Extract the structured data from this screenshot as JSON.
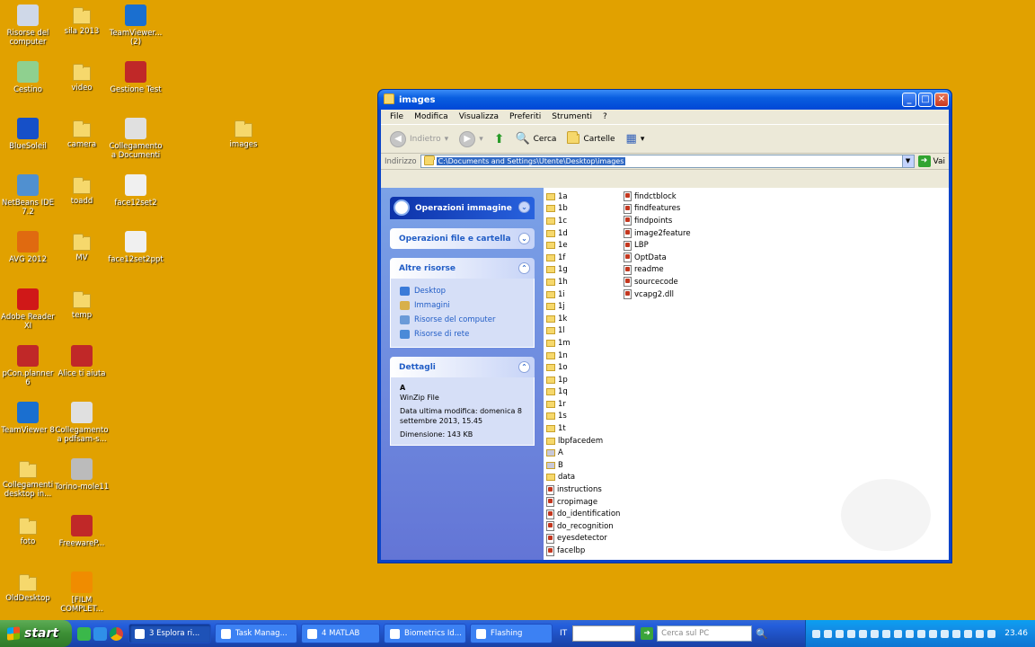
{
  "desktop": {
    "icons": [
      {
        "label": "Risorse del computer",
        "icon": "computer-icon"
      },
      {
        "label": "sila 2013",
        "icon": "folder-icon"
      },
      {
        "label": "TeamViewer... (2)",
        "icon": "teamviewer-icon"
      },
      {
        "label": "Cestino",
        "icon": "recycle-bin-icon"
      },
      {
        "label": "video",
        "icon": "folder-icon"
      },
      {
        "label": "Gestione Test",
        "icon": "app-icon"
      },
      {
        "label": "BlueSoleil",
        "icon": "bluetooth-icon"
      },
      {
        "label": "camera",
        "icon": "folder-icon"
      },
      {
        "label": "Collegamento a Documenti",
        "icon": "shortcut-icon"
      },
      {
        "label": "images",
        "icon": "folder-icon"
      },
      {
        "label": "NetBeans IDE 7.2",
        "icon": "netbeans-icon"
      },
      {
        "label": "toadd",
        "icon": "folder-icon"
      },
      {
        "label": "face12set2",
        "icon": "file-icon"
      },
      {
        "label": "AVG 2012",
        "icon": "avg-icon"
      },
      {
        "label": "MV",
        "icon": "folder-icon"
      },
      {
        "label": "face12set2ppt",
        "icon": "file-icon"
      },
      {
        "label": "Adobe Reader XI",
        "icon": "adobe-icon"
      },
      {
        "label": "temp",
        "icon": "folder-icon"
      },
      {
        "label": "pCon.planner 6",
        "icon": "app-icon"
      },
      {
        "label": "Alice ti aiuta",
        "icon": "app-icon"
      },
      {
        "label": "TeamViewer 8",
        "icon": "teamviewer-icon"
      },
      {
        "label": "Collegamento a pdfsam-s...",
        "icon": "shortcut-icon"
      },
      {
        "label": "Collegamenti desktop in...",
        "icon": "folder-icon"
      },
      {
        "label": "Torino-mole11",
        "icon": "image-icon"
      },
      {
        "label": "foto",
        "icon": "folder-icon"
      },
      {
        "label": "FreewareP...",
        "icon": "app-icon"
      },
      {
        "label": "OldDesktop",
        "icon": "folder-icon"
      },
      {
        "label": "[FILM COMPLET...",
        "icon": "vlc-icon"
      }
    ]
  },
  "window": {
    "title": "images",
    "menu": [
      "File",
      "Modifica",
      "Visualizza",
      "Preferiti",
      "Strumenti",
      "?"
    ],
    "toolbar": {
      "back": "Indietro",
      "search": "Cerca",
      "folders": "Cartelle"
    },
    "address": {
      "label": "Indirizzo",
      "value": "C:\\Documents and Settings\\Utente\\Desktop\\images",
      "go": "Vai"
    },
    "tasks": {
      "image_ops": "Operazioni immagine",
      "file_ops": "Operazioni file e cartella",
      "other": "Altre risorse",
      "links": [
        "Desktop",
        "Immagini",
        "Risorse del computer",
        "Risorse di rete"
      ],
      "details_title": "Dettagli",
      "details": {
        "name": "A",
        "type": "WinZip File",
        "modified": "Data ultima modifica: domenica 8 settembre 2013, 15.45",
        "size": "Dimensione: 143 KB"
      }
    },
    "files_col1": [
      {
        "name": "1a",
        "type": "folder"
      },
      {
        "name": "1b",
        "type": "folder"
      },
      {
        "name": "1c",
        "type": "folder"
      },
      {
        "name": "1d",
        "type": "folder"
      },
      {
        "name": "1e",
        "type": "folder"
      },
      {
        "name": "1f",
        "type": "folder"
      },
      {
        "name": "1g",
        "type": "folder"
      },
      {
        "name": "1h",
        "type": "folder"
      },
      {
        "name": "1i",
        "type": "folder"
      },
      {
        "name": "1j",
        "type": "folder"
      },
      {
        "name": "1k",
        "type": "folder"
      },
      {
        "name": "1l",
        "type": "folder"
      },
      {
        "name": "1m",
        "type": "folder"
      },
      {
        "name": "1n",
        "type": "folder"
      },
      {
        "name": "1o",
        "type": "folder"
      },
      {
        "name": "1p",
        "type": "folder"
      },
      {
        "name": "1q",
        "type": "folder"
      },
      {
        "name": "1r",
        "type": "folder"
      },
      {
        "name": "1s",
        "type": "folder"
      },
      {
        "name": "1t",
        "type": "folder"
      },
      {
        "name": "lbpfacedem",
        "type": "folder"
      },
      {
        "name": "A",
        "type": "zip"
      },
      {
        "name": "B",
        "type": "zip"
      },
      {
        "name": "data",
        "type": "folder"
      },
      {
        "name": "instructions",
        "type": "file"
      },
      {
        "name": "cropimage",
        "type": "matlab"
      },
      {
        "name": "do_identification",
        "type": "matlab"
      },
      {
        "name": "do_recognition",
        "type": "matlab"
      },
      {
        "name": "eyesdetector",
        "type": "matlab"
      },
      {
        "name": "facelbp",
        "type": "matlab"
      }
    ],
    "files_col2": [
      {
        "name": "findctblock",
        "type": "matlab"
      },
      {
        "name": "findfeatures",
        "type": "matlab"
      },
      {
        "name": "findpoints",
        "type": "matlab"
      },
      {
        "name": "image2feature",
        "type": "matlab"
      },
      {
        "name": "LBP",
        "type": "matlab"
      },
      {
        "name": "OptData",
        "type": "matlab"
      },
      {
        "name": "readme",
        "type": "matlab"
      },
      {
        "name": "sourcecode",
        "type": "matlab"
      },
      {
        "name": "vcapg2.dll",
        "type": "dll"
      }
    ]
  },
  "taskbar": {
    "start": "start",
    "tasks": [
      {
        "label": "3 Esplora ri...",
        "icon": "folder-icon"
      },
      {
        "label": "Task Manag...",
        "icon": "taskmanager-icon"
      },
      {
        "label": "4 MATLAB",
        "icon": "matlab-icon"
      },
      {
        "label": "Biometrics Id...",
        "icon": "chrome-icon"
      },
      {
        "label": "Flashing",
        "icon": "app-icon"
      }
    ],
    "lang": "IT",
    "search_placeholder": "Cerca sul PC",
    "clock": "23.46"
  }
}
